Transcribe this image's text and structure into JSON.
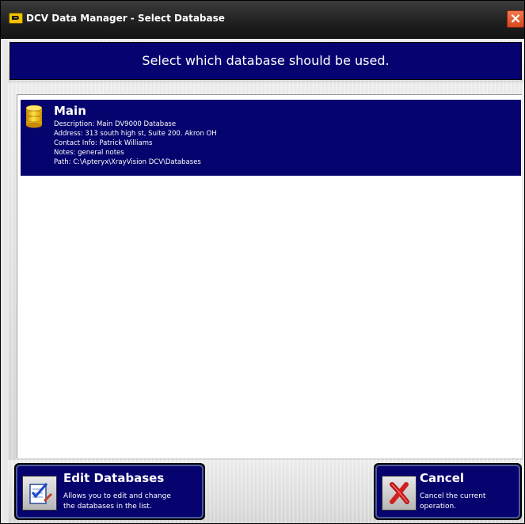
{
  "window": {
    "title": "DCV Data Manager - Select Database",
    "close_label": "×"
  },
  "header": {
    "prompt": "Select which database should be used."
  },
  "databases": [
    {
      "name": "Main",
      "description": "Description: Main DV9000 Database",
      "address": "Address: 313 south high st, Suite 200. Akron OH",
      "contact": "Contact Info: Patrick Williams",
      "notes": "Notes: general notes",
      "path": "Path: C:\\Apteryx\\XrayVision DCV\\Databases",
      "selected": true,
      "icon": "database-icon"
    }
  ],
  "buttons": {
    "edit": {
      "title": "Edit Databases",
      "desc_line1": "Allows you to edit and change",
      "desc_line2": "the databases in the list.",
      "icon": "edit-checklist-icon"
    },
    "cancel": {
      "title": "Cancel",
      "desc_line1": "Cancel the current",
      "desc_line2": "operation.",
      "icon": "red-x-icon"
    }
  },
  "colors": {
    "panel_blue": "#06026e",
    "titlebar": "#1f1f1f",
    "close_red": "#d7481f"
  }
}
